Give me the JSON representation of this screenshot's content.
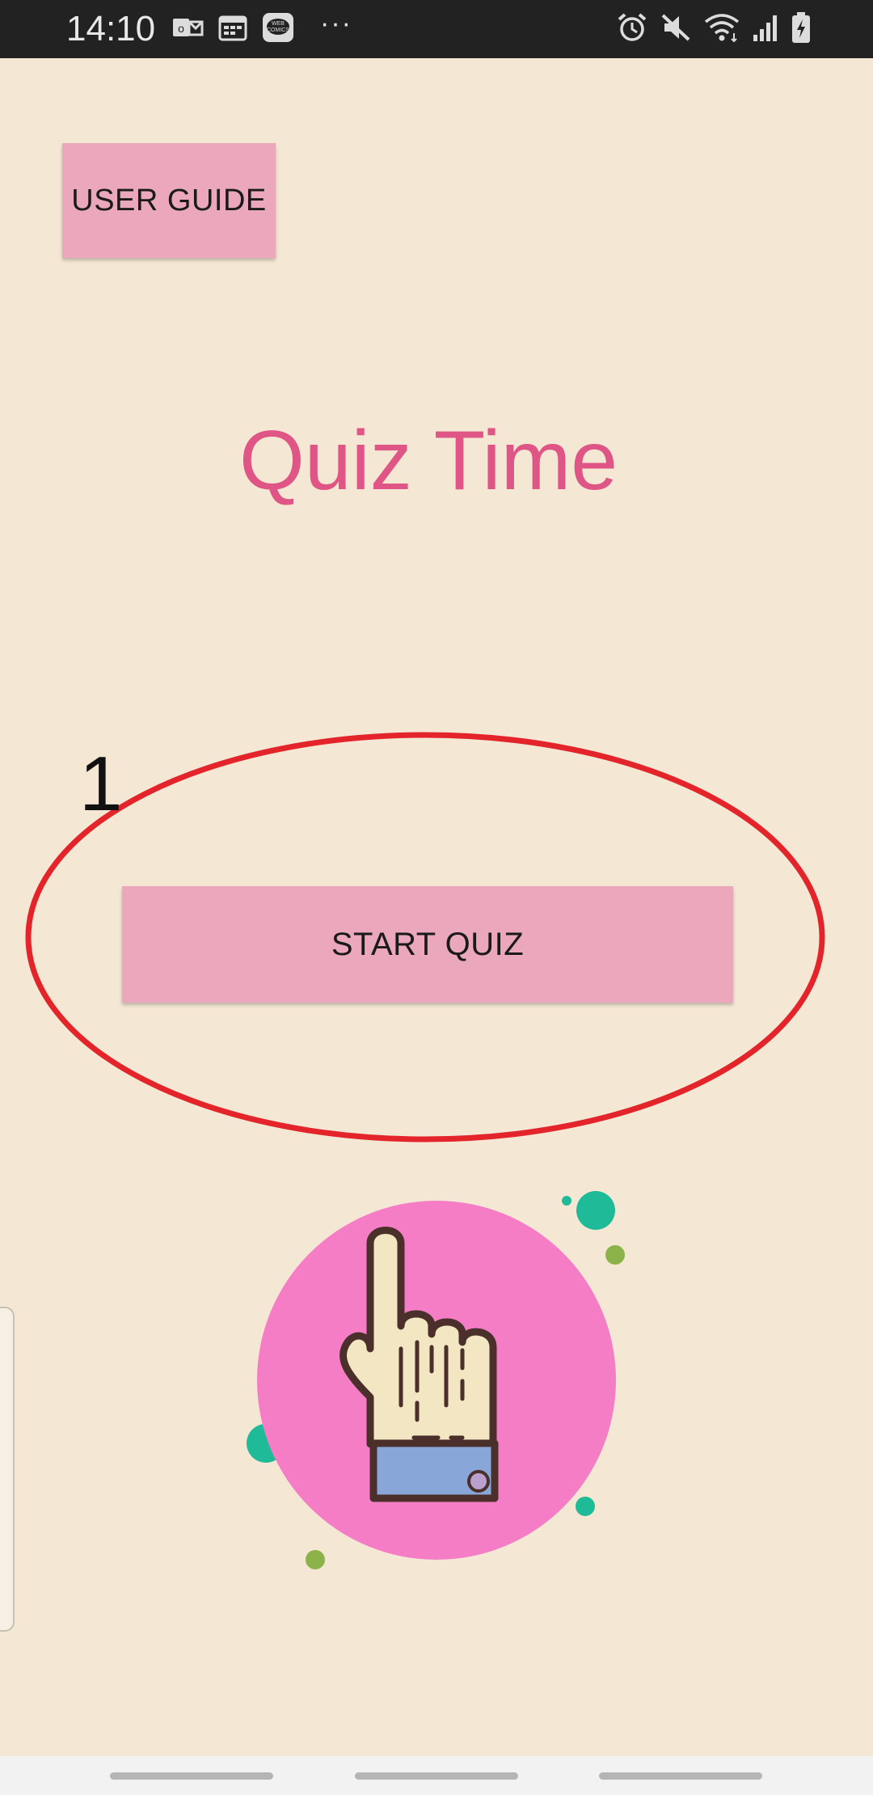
{
  "status_bar": {
    "time": "14:10",
    "left_icons": [
      "outlook-icon",
      "calendar-icon",
      "webcomics-icon"
    ],
    "overflow": "···",
    "right_icons": [
      "alarm-icon",
      "mute-icon",
      "wifi-icon",
      "signal-icon",
      "battery-charging-icon"
    ]
  },
  "header": {
    "user_guide_label": "USER GUIDE"
  },
  "main": {
    "title": "Quiz Time",
    "start_quiz_label": "START QUIZ"
  },
  "annotation": {
    "number": "1",
    "color": "#e3242b"
  },
  "illustration": {
    "icon": "pointing-hand-icon",
    "circle_color": "#f47dc6",
    "dot_colors": [
      "#1fbb98",
      "#8cb34a"
    ]
  },
  "colors": {
    "background": "#f4e7d4",
    "button": "#eba8bd",
    "title": "#df5585"
  }
}
